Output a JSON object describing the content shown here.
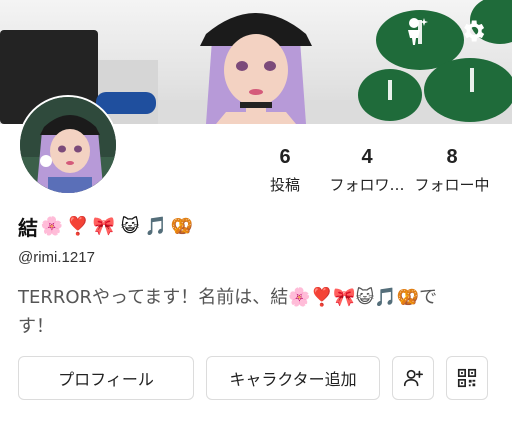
{
  "header": {
    "avatar_action_icon": "person-sparkle-icon",
    "settings_icon": "gear-icon"
  },
  "stats": [
    {
      "value": "6",
      "label": "投稿"
    },
    {
      "value": "4",
      "label": "フォロワ…"
    },
    {
      "value": "8",
      "label": "フォロー中"
    }
  ],
  "profile": {
    "name": "結",
    "name_emojis": [
      "🌸",
      "❣️",
      "🎀",
      "😺",
      "🎵",
      "🥨"
    ],
    "handle": "@rimi.1217",
    "bio_line1": "TERRORやってます！名前は、結🌸❣️🎀😺🎵🥨で",
    "bio_line2": "す！"
  },
  "actions": {
    "profile_label": "プロフィール",
    "character_label": "キャラクター追加",
    "add_friend_icon": "add-person-icon",
    "qr_icon": "qr-code-icon"
  },
  "colors": {
    "text_primary": "#111111",
    "text_secondary": "#555555",
    "border": "#dcdcdc"
  }
}
